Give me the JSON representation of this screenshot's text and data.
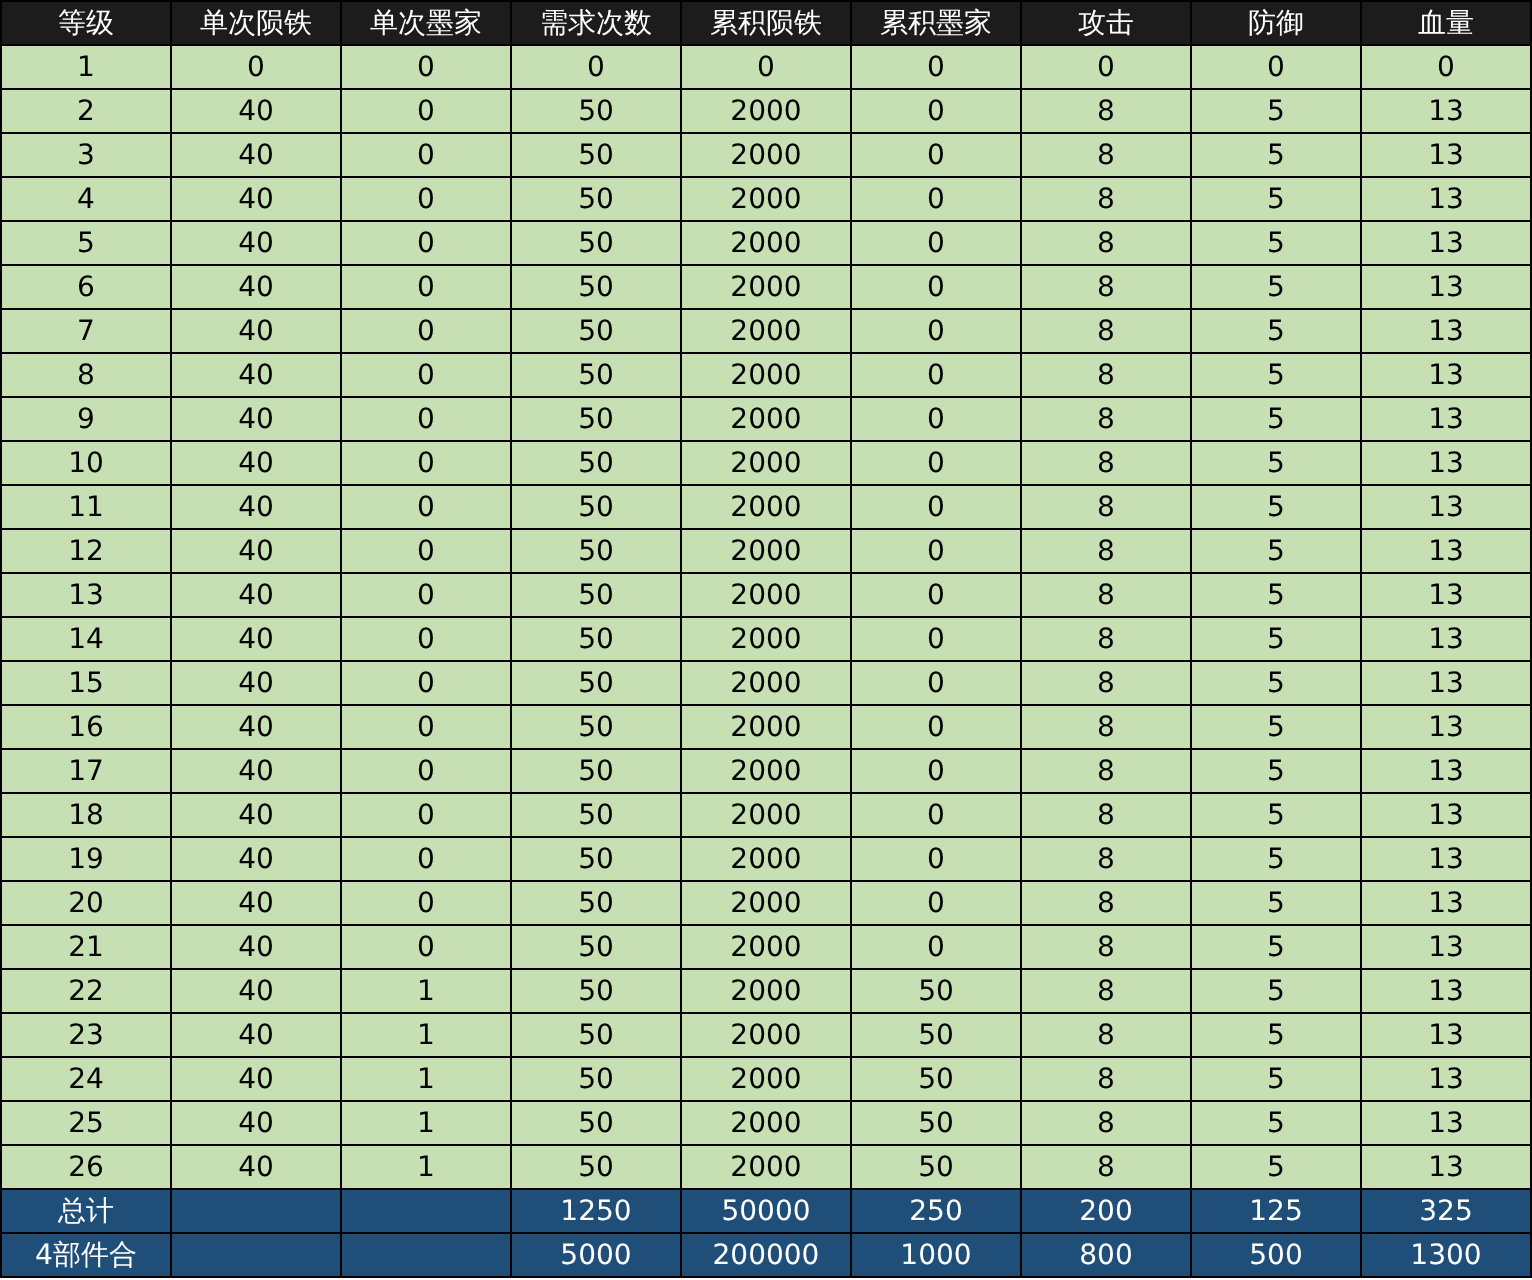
{
  "table": {
    "columns": [
      "等级",
      "单次陨铁",
      "单次墨家",
      "需求次数",
      "累积陨铁",
      "累积墨家",
      "攻击",
      "防御",
      "血量"
    ],
    "rows": [
      [
        "1",
        "0",
        "0",
        "0",
        "0",
        "0",
        "0",
        "0",
        "0"
      ],
      [
        "2",
        "40",
        "0",
        "50",
        "2000",
        "0",
        "8",
        "5",
        "13"
      ],
      [
        "3",
        "40",
        "0",
        "50",
        "2000",
        "0",
        "8",
        "5",
        "13"
      ],
      [
        "4",
        "40",
        "0",
        "50",
        "2000",
        "0",
        "8",
        "5",
        "13"
      ],
      [
        "5",
        "40",
        "0",
        "50",
        "2000",
        "0",
        "8",
        "5",
        "13"
      ],
      [
        "6",
        "40",
        "0",
        "50",
        "2000",
        "0",
        "8",
        "5",
        "13"
      ],
      [
        "7",
        "40",
        "0",
        "50",
        "2000",
        "0",
        "8",
        "5",
        "13"
      ],
      [
        "8",
        "40",
        "0",
        "50",
        "2000",
        "0",
        "8",
        "5",
        "13"
      ],
      [
        "9",
        "40",
        "0",
        "50",
        "2000",
        "0",
        "8",
        "5",
        "13"
      ],
      [
        "10",
        "40",
        "0",
        "50",
        "2000",
        "0",
        "8",
        "5",
        "13"
      ],
      [
        "11",
        "40",
        "0",
        "50",
        "2000",
        "0",
        "8",
        "5",
        "13"
      ],
      [
        "12",
        "40",
        "0",
        "50",
        "2000",
        "0",
        "8",
        "5",
        "13"
      ],
      [
        "13",
        "40",
        "0",
        "50",
        "2000",
        "0",
        "8",
        "5",
        "13"
      ],
      [
        "14",
        "40",
        "0",
        "50",
        "2000",
        "0",
        "8",
        "5",
        "13"
      ],
      [
        "15",
        "40",
        "0",
        "50",
        "2000",
        "0",
        "8",
        "5",
        "13"
      ],
      [
        "16",
        "40",
        "0",
        "50",
        "2000",
        "0",
        "8",
        "5",
        "13"
      ],
      [
        "17",
        "40",
        "0",
        "50",
        "2000",
        "0",
        "8",
        "5",
        "13"
      ],
      [
        "18",
        "40",
        "0",
        "50",
        "2000",
        "0",
        "8",
        "5",
        "13"
      ],
      [
        "19",
        "40",
        "0",
        "50",
        "2000",
        "0",
        "8",
        "5",
        "13"
      ],
      [
        "20",
        "40",
        "0",
        "50",
        "2000",
        "0",
        "8",
        "5",
        "13"
      ],
      [
        "21",
        "40",
        "0",
        "50",
        "2000",
        "0",
        "8",
        "5",
        "13"
      ],
      [
        "22",
        "40",
        "1",
        "50",
        "2000",
        "50",
        "8",
        "5",
        "13"
      ],
      [
        "23",
        "40",
        "1",
        "50",
        "2000",
        "50",
        "8",
        "5",
        "13"
      ],
      [
        "24",
        "40",
        "1",
        "50",
        "2000",
        "50",
        "8",
        "5",
        "13"
      ],
      [
        "25",
        "40",
        "1",
        "50",
        "2000",
        "50",
        "8",
        "5",
        "13"
      ],
      [
        "26",
        "40",
        "1",
        "50",
        "2000",
        "50",
        "8",
        "5",
        "13"
      ]
    ],
    "footer": [
      {
        "label": "总计",
        "values": [
          "1250",
          "50000",
          "250",
          "200",
          "125",
          "325"
        ]
      },
      {
        "label": "4部件合",
        "values": [
          "5000",
          "200000",
          "1000",
          "800",
          "500",
          "1300"
        ]
      }
    ]
  }
}
